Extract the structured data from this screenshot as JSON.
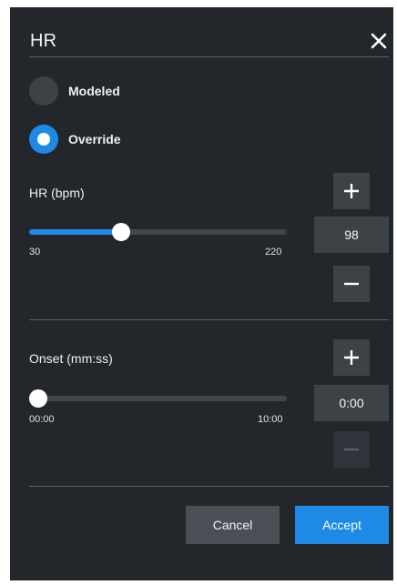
{
  "dialog": {
    "title": "HR"
  },
  "mode": {
    "options": [
      {
        "label": "Modeled",
        "selected": false
      },
      {
        "label": "Override",
        "selected": true
      }
    ]
  },
  "hr": {
    "label": "HR (bpm)",
    "value": "98",
    "min_label": "30",
    "max_label": "220",
    "min": 30,
    "max": 220,
    "current": 98
  },
  "onset": {
    "label": "Onset (mm:ss)",
    "value": "0:00",
    "min_label": "00:00",
    "max_label": "10:00",
    "min": 0,
    "max": 600,
    "current": 0
  },
  "actions": {
    "cancel_label": "Cancel",
    "accept_label": "Accept"
  },
  "colors": {
    "panel": "#23272b",
    "accent": "#1e8ae6",
    "control": "#3d4247"
  }
}
